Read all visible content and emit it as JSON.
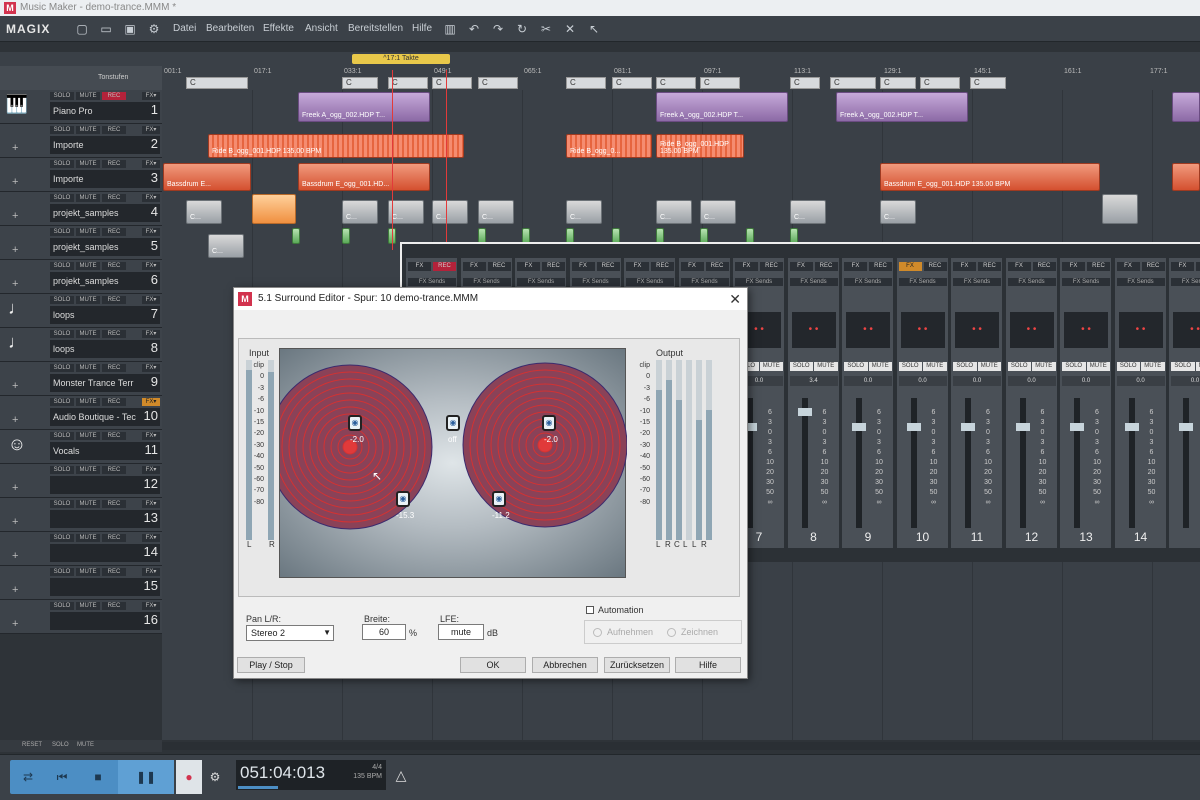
{
  "window": {
    "title": "Music Maker - demo-trance.MMM *",
    "brand": "MAGIX"
  },
  "menu": [
    "Datei",
    "Bearbeiten",
    "Effekte",
    "Ansicht",
    "Bereitstellen",
    "Hilfe"
  ],
  "ruler": {
    "label": "Tonstufen",
    "tempo": "^17:1 Takte",
    "marks": [
      "001:1",
      "017:1",
      "033:1",
      "049:1",
      "065:1",
      "081:1",
      "097:1",
      "113:1",
      "129:1",
      "145:1",
      "161:1",
      "177:1"
    ],
    "chord": "C"
  },
  "tracks": [
    {
      "name": "Piano Pro",
      "num": "1"
    },
    {
      "name": "Importe",
      "num": "2"
    },
    {
      "name": "Importe",
      "num": "3"
    },
    {
      "name": "projekt_samples",
      "num": "4"
    },
    {
      "name": "projekt_samples",
      "num": "5"
    },
    {
      "name": "projekt_samples",
      "num": "6"
    },
    {
      "name": "loops",
      "num": "7"
    },
    {
      "name": "loops",
      "num": "8"
    },
    {
      "name": "Monster Trance Terr",
      "num": "9"
    },
    {
      "name": "Audio Boutique - Tec",
      "num": "10"
    },
    {
      "name": "Vocals",
      "num": "11"
    },
    {
      "name": "",
      "num": "12"
    },
    {
      "name": "",
      "num": "13"
    },
    {
      "name": "",
      "num": "14"
    },
    {
      "name": "",
      "num": "15"
    },
    {
      "name": "",
      "num": "16"
    }
  ],
  "trackbtn": {
    "solo": "SOLO",
    "mute": "MUTE",
    "rec": "REC",
    "fx": "FX▾",
    "reset": "RESET"
  },
  "clips": {
    "purple": "Freek A_ogg_002.HDP  T...",
    "ride": "Ride B_ogg_001.HDP  135.00 BPM",
    "ride_short": "Ride B_ogg_0...",
    "bass": "Bassdrum E_ogg_001.HDP  135.00 BPM",
    "bass_short": "Bassdrum E...",
    "bass_mid": "Bassdrum E_ogg_001.HD...",
    "gray": "C..."
  },
  "mixer": {
    "fx": "FX",
    "rec": "REC",
    "sends": "FX Sends",
    "solo": "SOLO",
    "mute": "MUTE",
    "vol1": "0.0",
    "vol2": "3.4",
    "scale": [
      "6",
      "3",
      "0",
      "3",
      "6",
      "10",
      "20",
      "30",
      "50",
      "∞"
    ],
    "nums": [
      "7",
      "8",
      "9",
      "10",
      "11",
      "12",
      "13",
      "14"
    ]
  },
  "dialog": {
    "title": "5.1 Surround Editor - Spur: 10     demo-trance.MMM",
    "input": "Input",
    "output": "Output",
    "clip": "clip",
    "inscale": [
      "0",
      "-3",
      "-6",
      "-10",
      "-15",
      "-20",
      "-30",
      "-40",
      "-50",
      "-60",
      "-70",
      "-80"
    ],
    "outscale": [
      "0",
      "-3",
      "-6",
      "-10",
      "-15",
      "-20",
      "-30",
      "-40",
      "-50",
      "-60",
      "-70",
      "-80"
    ],
    "inch": [
      "L",
      "R"
    ],
    "outch": [
      "L",
      "R",
      "C",
      "L",
      "L",
      "R"
    ],
    "speakers": {
      "fl": "-2.0",
      "c": "off",
      "fr": "-2.0",
      "rl": "-15.3",
      "rr": "-11.2"
    },
    "pan_label": "Pan L/R:",
    "pan_value": "Stereo 2",
    "width_label": "Breite:",
    "width_value": "60",
    "width_unit": "%",
    "lfe_label": "LFE:",
    "lfe_value": "mute",
    "lfe_unit": "dB",
    "automation": "Automation",
    "record": "Aufnehmen",
    "draw": "Zeichnen",
    "play": "Play / Stop",
    "ok": "OK",
    "cancel": "Abbrechen",
    "reset": "Zurücksetzen",
    "help": "Hilfe"
  },
  "transport": {
    "time": "051:04:013",
    "sig": "4/4",
    "bpm": "135 BPM"
  }
}
